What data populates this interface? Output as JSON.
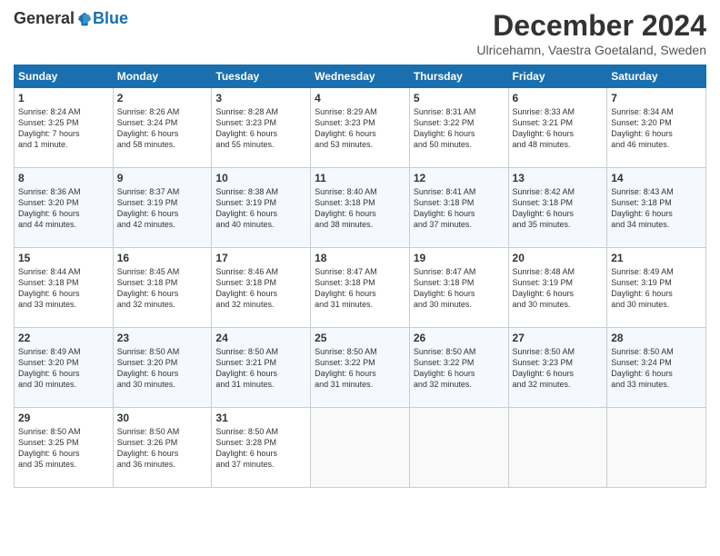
{
  "logo": {
    "general": "General",
    "blue": "Blue"
  },
  "header": {
    "month": "December 2024",
    "location": "Ulricehamn, Vaestra Goetaland, Sweden"
  },
  "weekdays": [
    "Sunday",
    "Monday",
    "Tuesday",
    "Wednesday",
    "Thursday",
    "Friday",
    "Saturday"
  ],
  "weeks": [
    [
      {
        "day": "1",
        "text": "Sunrise: 8:24 AM\nSunset: 3:25 PM\nDaylight: 7 hours\nand 1 minute."
      },
      {
        "day": "2",
        "text": "Sunrise: 8:26 AM\nSunset: 3:24 PM\nDaylight: 6 hours\nand 58 minutes."
      },
      {
        "day": "3",
        "text": "Sunrise: 8:28 AM\nSunset: 3:23 PM\nDaylight: 6 hours\nand 55 minutes."
      },
      {
        "day": "4",
        "text": "Sunrise: 8:29 AM\nSunset: 3:23 PM\nDaylight: 6 hours\nand 53 minutes."
      },
      {
        "day": "5",
        "text": "Sunrise: 8:31 AM\nSunset: 3:22 PM\nDaylight: 6 hours\nand 50 minutes."
      },
      {
        "day": "6",
        "text": "Sunrise: 8:33 AM\nSunset: 3:21 PM\nDaylight: 6 hours\nand 48 minutes."
      },
      {
        "day": "7",
        "text": "Sunrise: 8:34 AM\nSunset: 3:20 PM\nDaylight: 6 hours\nand 46 minutes."
      }
    ],
    [
      {
        "day": "8",
        "text": "Sunrise: 8:36 AM\nSunset: 3:20 PM\nDaylight: 6 hours\nand 44 minutes."
      },
      {
        "day": "9",
        "text": "Sunrise: 8:37 AM\nSunset: 3:19 PM\nDaylight: 6 hours\nand 42 minutes."
      },
      {
        "day": "10",
        "text": "Sunrise: 8:38 AM\nSunset: 3:19 PM\nDaylight: 6 hours\nand 40 minutes."
      },
      {
        "day": "11",
        "text": "Sunrise: 8:40 AM\nSunset: 3:18 PM\nDaylight: 6 hours\nand 38 minutes."
      },
      {
        "day": "12",
        "text": "Sunrise: 8:41 AM\nSunset: 3:18 PM\nDaylight: 6 hours\nand 37 minutes."
      },
      {
        "day": "13",
        "text": "Sunrise: 8:42 AM\nSunset: 3:18 PM\nDaylight: 6 hours\nand 35 minutes."
      },
      {
        "day": "14",
        "text": "Sunrise: 8:43 AM\nSunset: 3:18 PM\nDaylight: 6 hours\nand 34 minutes."
      }
    ],
    [
      {
        "day": "15",
        "text": "Sunrise: 8:44 AM\nSunset: 3:18 PM\nDaylight: 6 hours\nand 33 minutes."
      },
      {
        "day": "16",
        "text": "Sunrise: 8:45 AM\nSunset: 3:18 PM\nDaylight: 6 hours\nand 32 minutes."
      },
      {
        "day": "17",
        "text": "Sunrise: 8:46 AM\nSunset: 3:18 PM\nDaylight: 6 hours\nand 32 minutes."
      },
      {
        "day": "18",
        "text": "Sunrise: 8:47 AM\nSunset: 3:18 PM\nDaylight: 6 hours\nand 31 minutes."
      },
      {
        "day": "19",
        "text": "Sunrise: 8:47 AM\nSunset: 3:18 PM\nDaylight: 6 hours\nand 30 minutes."
      },
      {
        "day": "20",
        "text": "Sunrise: 8:48 AM\nSunset: 3:19 PM\nDaylight: 6 hours\nand 30 minutes."
      },
      {
        "day": "21",
        "text": "Sunrise: 8:49 AM\nSunset: 3:19 PM\nDaylight: 6 hours\nand 30 minutes."
      }
    ],
    [
      {
        "day": "22",
        "text": "Sunrise: 8:49 AM\nSunset: 3:20 PM\nDaylight: 6 hours\nand 30 minutes."
      },
      {
        "day": "23",
        "text": "Sunrise: 8:50 AM\nSunset: 3:20 PM\nDaylight: 6 hours\nand 30 minutes."
      },
      {
        "day": "24",
        "text": "Sunrise: 8:50 AM\nSunset: 3:21 PM\nDaylight: 6 hours\nand 31 minutes."
      },
      {
        "day": "25",
        "text": "Sunrise: 8:50 AM\nSunset: 3:22 PM\nDaylight: 6 hours\nand 31 minutes."
      },
      {
        "day": "26",
        "text": "Sunrise: 8:50 AM\nSunset: 3:22 PM\nDaylight: 6 hours\nand 32 minutes."
      },
      {
        "day": "27",
        "text": "Sunrise: 8:50 AM\nSunset: 3:23 PM\nDaylight: 6 hours\nand 32 minutes."
      },
      {
        "day": "28",
        "text": "Sunrise: 8:50 AM\nSunset: 3:24 PM\nDaylight: 6 hours\nand 33 minutes."
      }
    ],
    [
      {
        "day": "29",
        "text": "Sunrise: 8:50 AM\nSunset: 3:25 PM\nDaylight: 6 hours\nand 35 minutes."
      },
      {
        "day": "30",
        "text": "Sunrise: 8:50 AM\nSunset: 3:26 PM\nDaylight: 6 hours\nand 36 minutes."
      },
      {
        "day": "31",
        "text": "Sunrise: 8:50 AM\nSunset: 3:28 PM\nDaylight: 6 hours\nand 37 minutes."
      },
      {
        "day": "",
        "text": ""
      },
      {
        "day": "",
        "text": ""
      },
      {
        "day": "",
        "text": ""
      },
      {
        "day": "",
        "text": ""
      }
    ]
  ]
}
